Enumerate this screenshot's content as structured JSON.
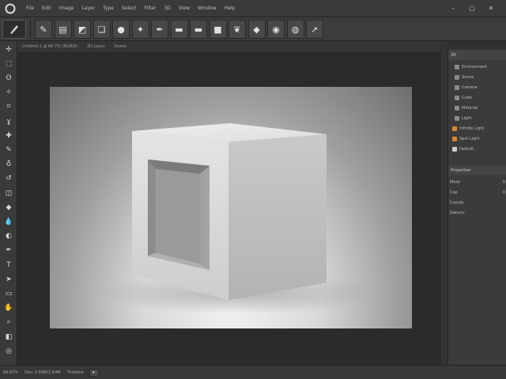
{
  "menu": {
    "items": [
      "File",
      "Edit",
      "Image",
      "Layer",
      "Type",
      "Select",
      "Filter",
      "3D",
      "View",
      "Window",
      "Help"
    ],
    "window_controls": [
      "–",
      "▢",
      "✕"
    ]
  },
  "options": {
    "tools": [
      {
        "name": "brush-icon",
        "glyph": "✎"
      },
      {
        "name": "document-icon",
        "glyph": "▤"
      },
      {
        "name": "swatch-icon",
        "glyph": "◩"
      },
      {
        "name": "layers-icon",
        "glyph": "❏"
      },
      {
        "name": "sphere-icon",
        "glyph": "●"
      },
      {
        "name": "bird-icon",
        "glyph": "✦"
      },
      {
        "name": "pen-icon",
        "glyph": "✒"
      },
      {
        "name": "gradient-icon",
        "glyph": "▬"
      },
      {
        "name": "ribbon-icon",
        "glyph": "▬"
      },
      {
        "name": "folder-icon",
        "glyph": "■"
      },
      {
        "name": "leaf-icon",
        "glyph": "❦"
      },
      {
        "name": "paint-icon",
        "glyph": "◆"
      },
      {
        "name": "wood-icon",
        "glyph": "◉"
      },
      {
        "name": "camera-icon",
        "glyph": "◍"
      },
      {
        "name": "arrow-icon",
        "glyph": "➚"
      }
    ]
  },
  "tabs": [
    "Untitled-1 @ 66.7% (RGB/8)",
    "3D Layer",
    "Scene"
  ],
  "toolbox": {
    "tools": [
      {
        "name": "move-tool-icon",
        "glyph": "✢"
      },
      {
        "name": "marquee-tool-icon",
        "glyph": "⬚"
      },
      {
        "name": "lasso-tool-icon",
        "glyph": "ʘ"
      },
      {
        "name": "wand-tool-icon",
        "glyph": "✧"
      },
      {
        "name": "crop-tool-icon",
        "glyph": "⌗"
      },
      {
        "name": "eyedropper-tool-icon",
        "glyph": "ɣ"
      },
      {
        "name": "heal-tool-icon",
        "glyph": "✚"
      },
      {
        "name": "brush-tool-icon",
        "glyph": "✎"
      },
      {
        "name": "stamp-tool-icon",
        "glyph": "♁"
      },
      {
        "name": "history-tool-icon",
        "glyph": "↺"
      },
      {
        "name": "eraser-tool-icon",
        "glyph": "◫"
      },
      {
        "name": "fill-tool-icon",
        "glyph": "◆"
      },
      {
        "name": "blur-tool-icon",
        "glyph": "💧"
      },
      {
        "name": "dodge-tool-icon",
        "glyph": "◐"
      },
      {
        "name": "pen-tool-icon",
        "glyph": "✒"
      },
      {
        "name": "type-tool-icon",
        "glyph": "T"
      },
      {
        "name": "path-tool-icon",
        "glyph": "➤"
      },
      {
        "name": "shape-tool-icon",
        "glyph": "▭"
      },
      {
        "name": "hand-tool-icon",
        "glyph": "✋"
      },
      {
        "name": "zoom-tool-icon",
        "glyph": "⌕"
      },
      {
        "name": "colors-icon",
        "glyph": "◧"
      },
      {
        "name": "quickmask-icon",
        "glyph": "◎"
      }
    ]
  },
  "panels": {
    "layers_title": "3D",
    "rows": [
      {
        "label": "Environment",
        "color": "#8a8a8a"
      },
      {
        "label": "Scene",
        "color": "#8a8a8a"
      },
      {
        "label": "Camera",
        "color": "#8a8a8a"
      },
      {
        "label": "Cube",
        "color": "#8a8a8a"
      },
      {
        "label": "Material",
        "color": "#8a8a8a"
      },
      {
        "label": "Light",
        "color": "#8a8a8a"
      },
      {
        "label": "Infinite Light",
        "color": "#d9892b"
      },
      {
        "label": "Spot Light",
        "color": "#d9892b"
      },
      {
        "label": "Default",
        "color": "#cccccc"
      }
    ],
    "props_title": "Properties",
    "props": [
      {
        "label": "Mesh",
        "value": "0"
      },
      {
        "label": "Cap",
        "value": "0"
      },
      {
        "label": "Coords",
        "value": ""
      },
      {
        "label": "Deform",
        "value": ""
      }
    ]
  },
  "status": {
    "zoom": "66.67%",
    "doc": "Doc: 2.64M/2.64M",
    "timeline": "Timeline"
  },
  "colors": {
    "accent": "#d9892b",
    "ui_dark": "#2b2b2b",
    "ui_panel": "#3b3b3b"
  }
}
